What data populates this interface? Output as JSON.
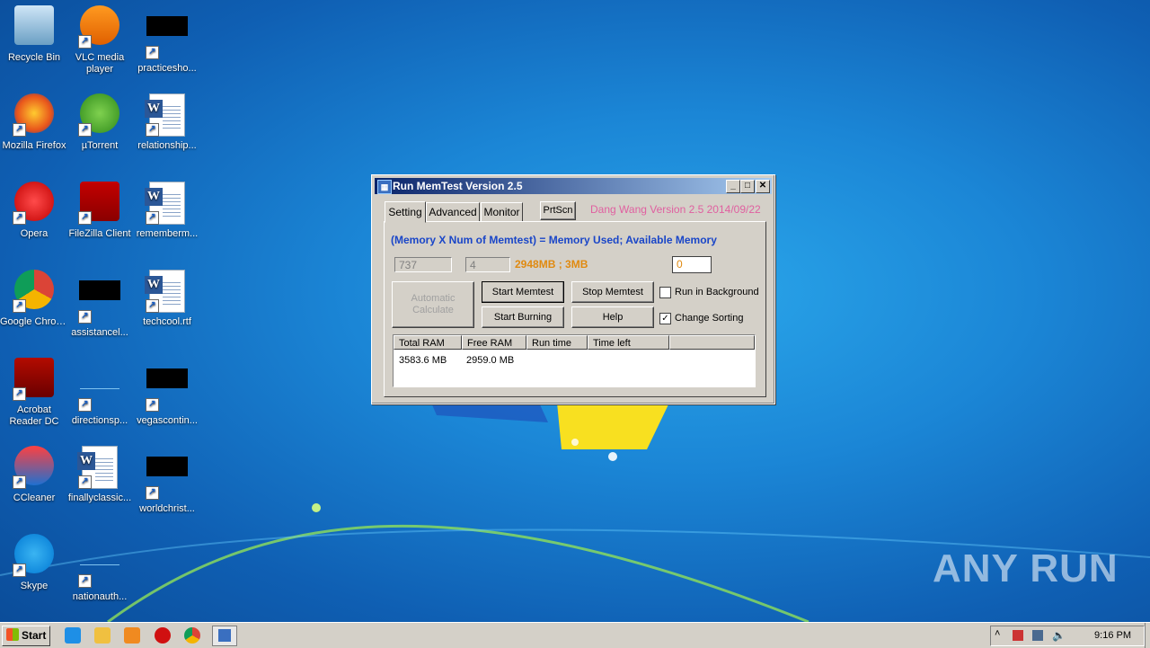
{
  "desktop": {
    "icons": [
      {
        "label": "Recycle Bin",
        "icon": "recycle-bin-icon"
      },
      {
        "label": "VLC media player",
        "icon": "vlc-icon"
      },
      {
        "label": "practicesho...",
        "icon": "file-icon"
      },
      {
        "label": "Mozilla Firefox",
        "icon": "firefox-icon"
      },
      {
        "label": "µTorrent",
        "icon": "utorrent-icon"
      },
      {
        "label": "relationship...",
        "icon": "word-doc-icon"
      },
      {
        "label": "Opera",
        "icon": "opera-icon"
      },
      {
        "label": "FileZilla Client",
        "icon": "filezilla-icon"
      },
      {
        "label": "rememberm...",
        "icon": "word-doc-icon"
      },
      {
        "label": "Google Chrome",
        "icon": "chrome-icon"
      },
      {
        "label": "assistancel...",
        "icon": "file-icon"
      },
      {
        "label": "techcool.rtf",
        "icon": "word-doc-icon"
      },
      {
        "label": "Acrobat Reader DC",
        "icon": "acrobat-icon"
      },
      {
        "label": "directionsp...",
        "icon": "file-icon"
      },
      {
        "label": "vegascontin...",
        "icon": "file-icon"
      },
      {
        "label": "CCleaner",
        "icon": "ccleaner-icon"
      },
      {
        "label": "finallyclassic...",
        "icon": "word-doc-icon"
      },
      {
        "label": "worldchrist...",
        "icon": "file-icon"
      },
      {
        "label": "Skype",
        "icon": "skype-icon"
      },
      {
        "label": "nationauth...",
        "icon": "file-icon"
      }
    ],
    "watermark": "ANY RUN"
  },
  "window": {
    "title": "Run MemTest Version 2.5",
    "controls": {
      "minimize": "_",
      "maximize": "□",
      "close": "✕"
    },
    "tabs": [
      "Setting",
      "Advanced",
      "Monitor"
    ],
    "prtscn_label": "PrtScn",
    "version_text": "Dang Wang Version 2.5 2014/09/22",
    "formula_text": "(Memory  X Num of Memtest) = Memory Used; Available Memory",
    "memory_value": "737",
    "num_memtest": "4",
    "memory_summary": "2948MB ; 3MB",
    "extra_value": "0",
    "buttons": {
      "auto_calc": "Automatic Calculate",
      "start_memtest": "Start Memtest",
      "stop_memtest": "Stop Memtest",
      "start_burning": "Start Burning",
      "help": "Help"
    },
    "checkboxes": [
      {
        "label": "Run in Background",
        "checked": false
      },
      {
        "label": "Change Sorting",
        "checked": true
      }
    ],
    "table": {
      "columns": [
        "Total RAM",
        "Free RAM",
        "Run time",
        "Time left"
      ],
      "rows": [
        [
          "3583.6 MB",
          "2959.0 MB",
          "",
          ""
        ]
      ]
    },
    "colors": {
      "version": "#e060a0",
      "formula": "#1a46c8",
      "summary": "#e08a10"
    }
  },
  "taskbar": {
    "start_label": "Start",
    "clock": "9:16 PM",
    "pinned": [
      "ie-icon",
      "explorer-icon",
      "media-player-icon",
      "opera-icon",
      "chrome-icon",
      "memtest-icon"
    ]
  }
}
